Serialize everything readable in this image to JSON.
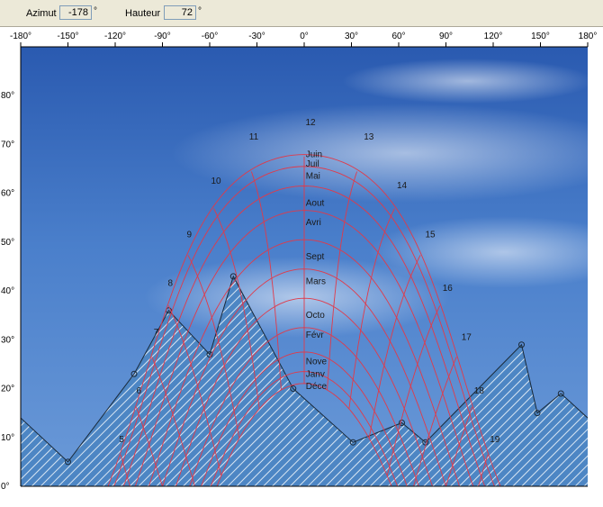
{
  "toolbar": {
    "azimut_label": "Azimut",
    "azimut_value": "-178",
    "azimut_unit": "°",
    "hauteur_label": "Hauteur",
    "hauteur_value": "72",
    "hauteur_unit": "°"
  },
  "chart_data": {
    "type": "line",
    "xlim": [
      -180,
      180
    ],
    "ylim": [
      0,
      90
    ],
    "xticks": [
      "-180°",
      "-150°",
      "-120°",
      "-90°",
      "-60°",
      "-30°",
      "0°",
      "30°",
      "60°",
      "90°",
      "120°",
      "150°",
      "180°"
    ],
    "yticks": [
      "0°",
      "10°",
      "20°",
      "30°",
      "40°",
      "50°",
      "60°",
      "70°",
      "80°"
    ],
    "skyline": [
      [
        -180,
        14
      ],
      [
        -150,
        5
      ],
      [
        -108,
        23
      ],
      [
        -86,
        36
      ],
      [
        -60,
        27
      ],
      [
        -45,
        43
      ],
      [
        -7,
        20
      ],
      [
        31,
        9
      ],
      [
        62,
        13
      ],
      [
        77,
        9
      ],
      [
        138,
        29
      ],
      [
        148,
        15
      ],
      [
        163,
        19
      ],
      [
        180,
        14
      ]
    ],
    "hour_labels": [
      {
        "t": "5",
        "az": -116,
        "alt": 9
      },
      {
        "t": "6",
        "az": -105,
        "alt": 19
      },
      {
        "t": "7",
        "az": -94,
        "alt": 31
      },
      {
        "t": "8",
        "az": -85,
        "alt": 41
      },
      {
        "t": "9",
        "az": -73,
        "alt": 51
      },
      {
        "t": "10",
        "az": -56,
        "alt": 62
      },
      {
        "t": "11",
        "az": -32,
        "alt": 71
      },
      {
        "t": "12",
        "az": 4,
        "alt": 74
      },
      {
        "t": "13",
        "az": 41,
        "alt": 71
      },
      {
        "t": "14",
        "az": 62,
        "alt": 61
      },
      {
        "t": "15",
        "az": 80,
        "alt": 51
      },
      {
        "t": "16",
        "az": 91,
        "alt": 40
      },
      {
        "t": "17",
        "az": 103,
        "alt": 30
      },
      {
        "t": "18",
        "az": 111,
        "alt": 19
      },
      {
        "t": "19",
        "az": 121,
        "alt": 9
      }
    ],
    "month_labels": [
      {
        "t": "Juin",
        "alt": 68
      },
      {
        "t": "Juil",
        "alt": 66
      },
      {
        "t": "Mai",
        "alt": 63.5
      },
      {
        "t": "Aout",
        "alt": 58
      },
      {
        "t": "Avri",
        "alt": 54
      },
      {
        "t": "Sept",
        "alt": 47
      },
      {
        "t": "Mars",
        "alt": 42
      },
      {
        "t": "Octo",
        "alt": 35
      },
      {
        "t": "Févr",
        "alt": 31
      },
      {
        "t": "Nove",
        "alt": 25.5
      },
      {
        "t": "Janv",
        "alt": 23
      },
      {
        "t": "Déce",
        "alt": 20.5
      }
    ]
  }
}
